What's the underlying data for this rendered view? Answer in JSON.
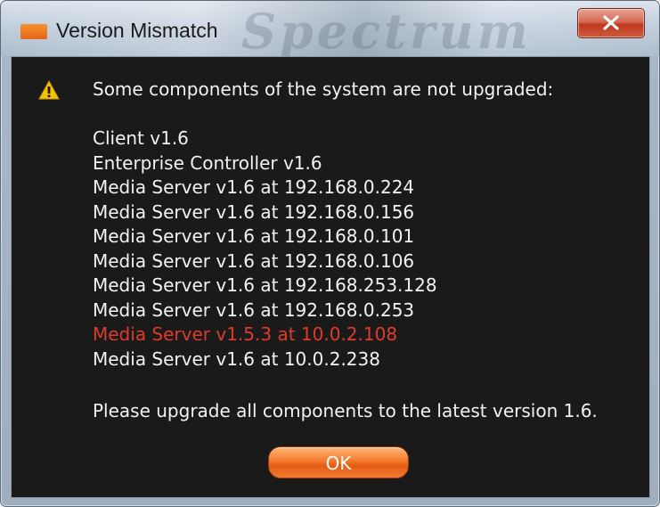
{
  "window": {
    "title": "Version Mismatch",
    "watermark": "Spectrum"
  },
  "dialog": {
    "heading": "Some components of the system are not upgraded:",
    "components": [
      {
        "text": "Client v1.6",
        "mismatch": false
      },
      {
        "text": "Enterprise Controller v1.6",
        "mismatch": false
      },
      {
        "text": "Media Server v1.6 at 192.168.0.224",
        "mismatch": false
      },
      {
        "text": "Media Server v1.6 at 192.168.0.156",
        "mismatch": false
      },
      {
        "text": "Media Server v1.6 at 192.168.0.101",
        "mismatch": false
      },
      {
        "text": "Media Server v1.6 at 192.168.0.106",
        "mismatch": false
      },
      {
        "text": "Media Server v1.6 at 192.168.253.128",
        "mismatch": false
      },
      {
        "text": "Media Server v1.6 at 192.168.0.253",
        "mismatch": false
      },
      {
        "text": "Media Server v1.5.3 at 10.0.2.108",
        "mismatch": true
      },
      {
        "text": "Media Server v1.6 at 10.0.2.238",
        "mismatch": false
      }
    ],
    "footer": "Please upgrade all components to the latest version 1.6.",
    "ok_label": "OK"
  },
  "icons": {
    "app": "app-logo-icon",
    "close": "close-icon",
    "warning": "warning-icon"
  },
  "colors": {
    "content_background": "#1a1a1a",
    "text": "#f2f2f2",
    "mismatch_text": "#e03a2a",
    "ok_button": "#f57a2c",
    "close_button": "#c0391f",
    "warning_icon": "#f5c400"
  }
}
